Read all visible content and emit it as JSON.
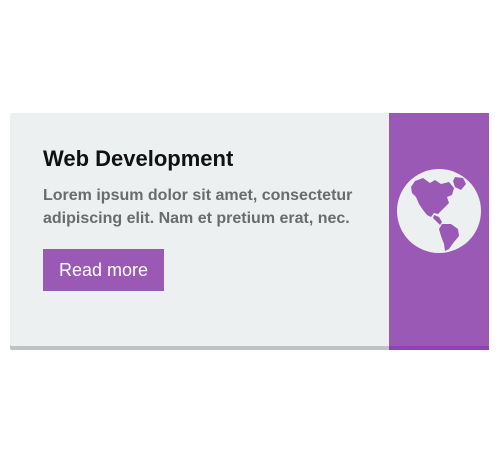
{
  "card": {
    "title": "Web Development",
    "description": "Lorem ipsum dolor sit amet, consectetur adipiscing elit. Nam et pretium erat, nec.",
    "button_label": "Read more",
    "icon": "globe-americas-icon"
  },
  "colors": {
    "accent": "#9b59b6",
    "card_background": "#ecf0f1",
    "title_text": "#111111",
    "body_text": "#6b6b6b"
  }
}
